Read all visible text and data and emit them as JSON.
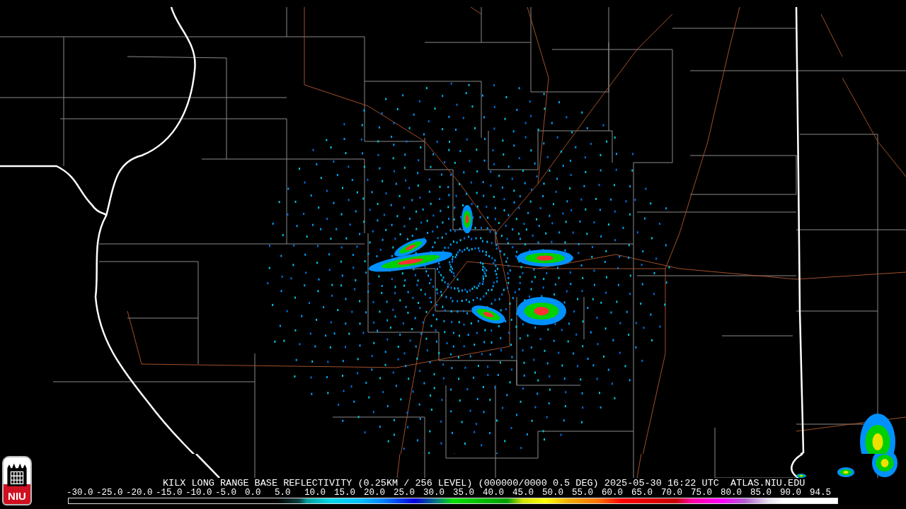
{
  "caption": "KILX LONG RANGE BASE REFLECTIVITY (0.25KM / 256 LEVEL) (000000/0000 0.5 DEG) 2025-05-30 16:22 UTC  ATLAS.NIU.EDU",
  "scale": {
    "labels": [
      "-30.0",
      "-25.0",
      "-20.0",
      "-15.0",
      "-10.0",
      "-5.0",
      "0.0",
      "5.0",
      "10.0",
      "15.0",
      "20.0",
      "25.0",
      "30.0",
      "35.0",
      "40.0",
      "45.0",
      "50.0",
      "55.0",
      "60.0",
      "65.0",
      "70.0",
      "75.0",
      "80.0",
      "85.0",
      "90.0",
      "94.5"
    ]
  },
  "logo": {
    "text": "NIU"
  }
}
